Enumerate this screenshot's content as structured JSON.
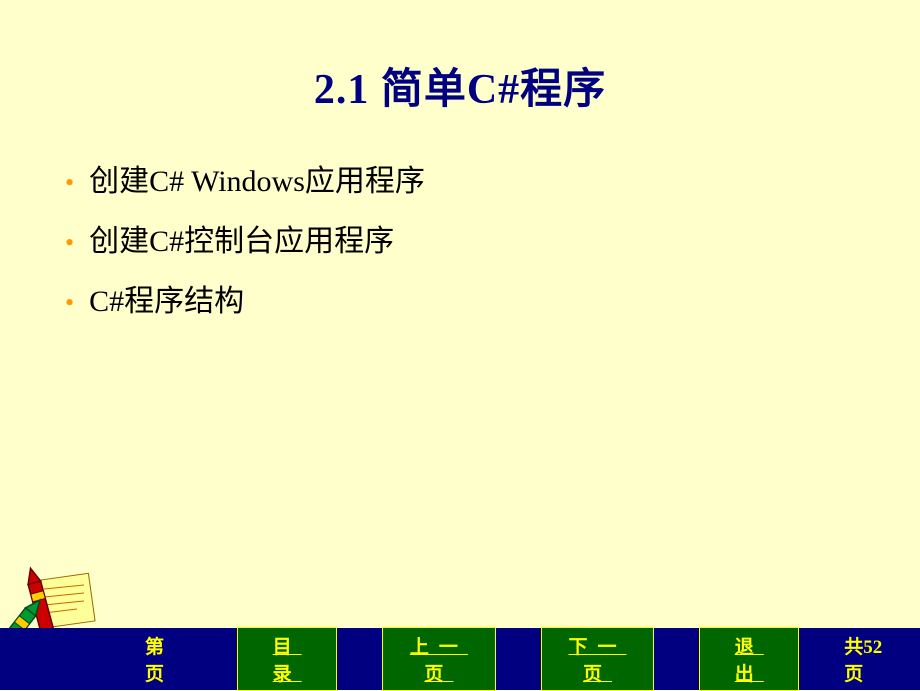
{
  "slide": {
    "title": "2.1  简单C#程序",
    "bullets": [
      "创建C#  Windows应用程序",
      "创建C#控制台应用程序",
      "C#程序结构"
    ]
  },
  "footer": {
    "page_current_label": "第页",
    "nav": {
      "toc": "目 录",
      "prev": "上一页",
      "next": "下一页",
      "exit": "退 出"
    },
    "page_total_prefix": "共",
    "page_total_number": "52",
    "page_total_suffix": "页"
  }
}
